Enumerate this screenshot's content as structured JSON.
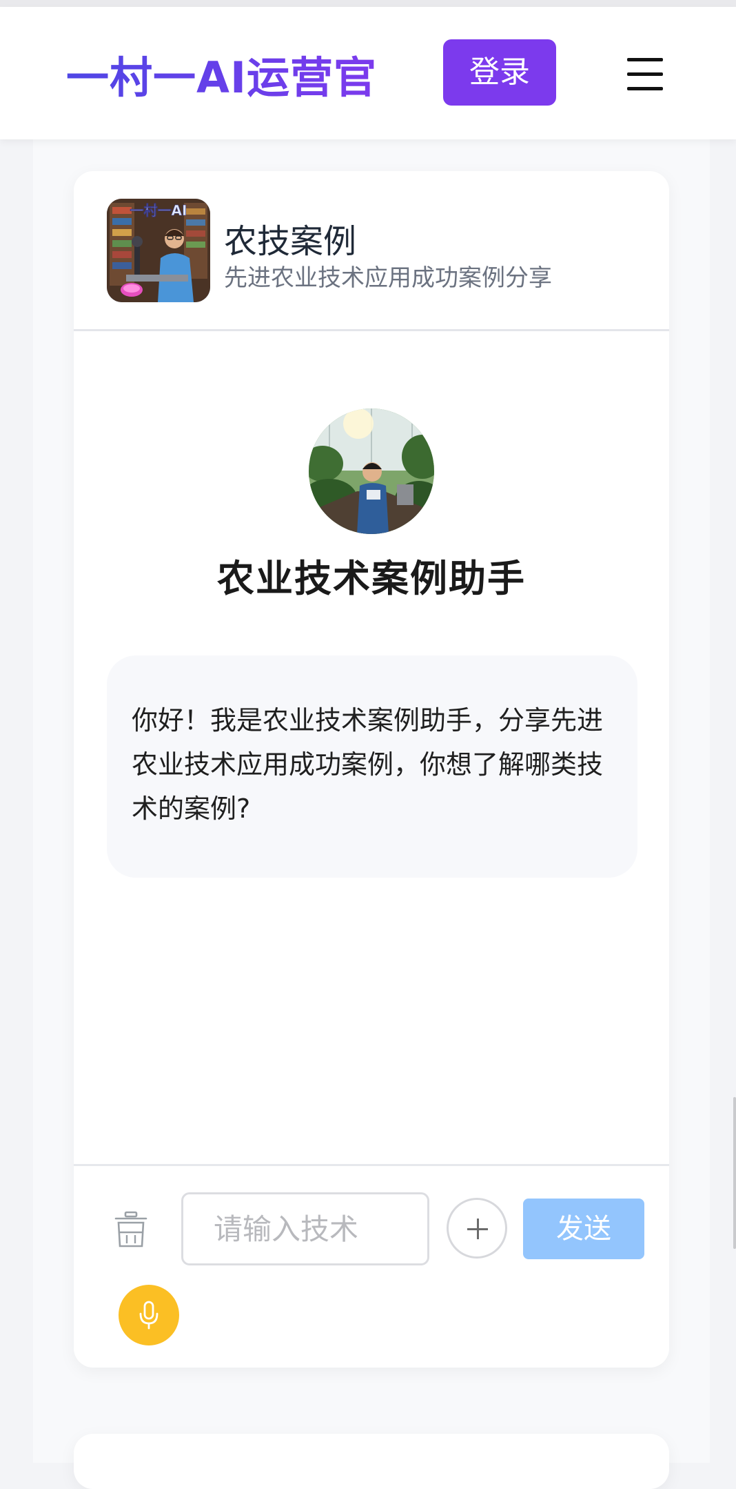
{
  "header": {
    "brand": "一村一AI运营官",
    "login_label": "登录"
  },
  "card": {
    "title": "农技案例",
    "subtitle": "先进农业技术应用成功案例分享"
  },
  "chat": {
    "assistant_name": "农业技术案例助手",
    "welcome_message": "你好！我是农业技术案例助手，分享先进农业技术应用成功案例，你想了解哪类技术的案例?"
  },
  "input": {
    "placeholder": "请输入技术",
    "value": "",
    "send_label": "发送"
  },
  "colors": {
    "brand_start": "#4f46e5",
    "brand_end": "#7c3aed",
    "login_bg": "#7c3aed",
    "send_bg": "#93c5fd",
    "mic_bg": "#fbbf24"
  },
  "icons": [
    "menu-icon",
    "trash-icon",
    "plus-icon",
    "microphone-icon"
  ]
}
